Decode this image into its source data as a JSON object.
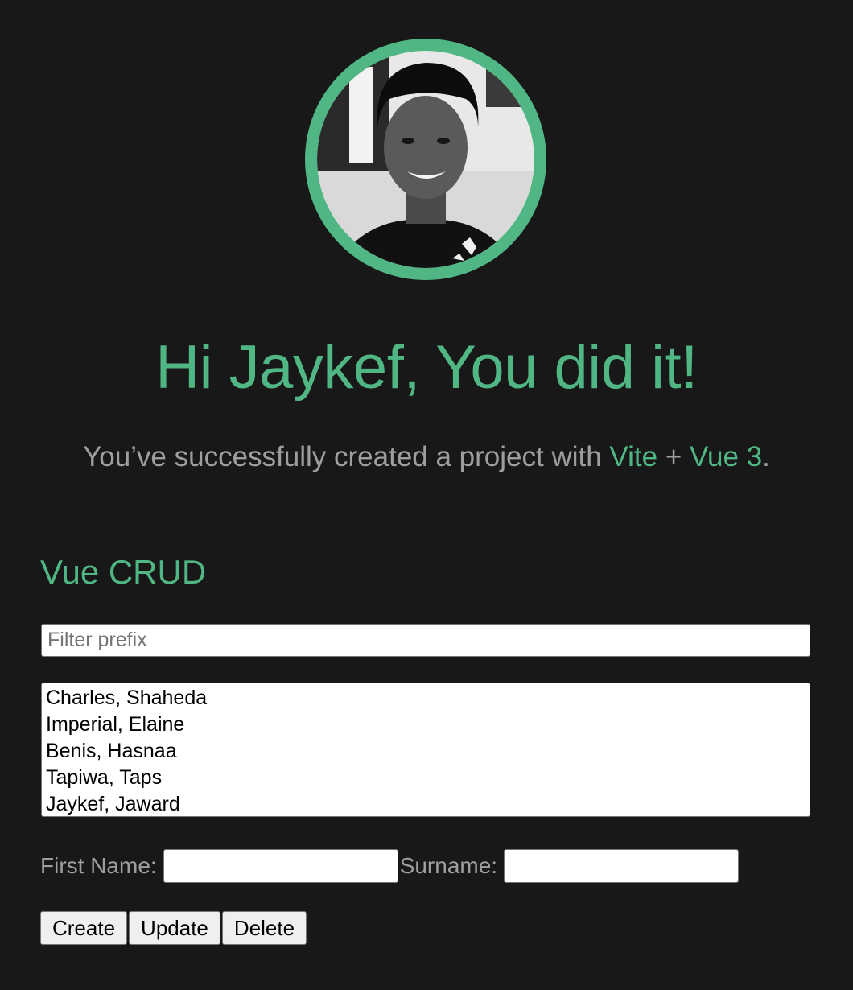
{
  "hero": {
    "greeting": "Hi Jaykef, You did it!",
    "subtitle_prefix": "You’ve successfully created a project with ",
    "link_vite": "Vite",
    "plus": " + ",
    "link_vue": "Vue 3",
    "period": "."
  },
  "crud": {
    "title": "Vue CRUD",
    "filter_placeholder": "Filter prefix",
    "filter_value": "",
    "people": [
      "Charles, Shaheda",
      "Imperial, Elaine",
      "Benis, Hasnaa",
      "Tapiwa, Taps",
      "Jaykef, Jaward"
    ],
    "first_name_label": "First Name:",
    "first_name_value": "",
    "surname_label": "Surname:",
    "surname_value": "",
    "buttons": {
      "create": "Create",
      "update": "Update",
      "delete": "Delete"
    }
  },
  "colors": {
    "accent": "#50b784",
    "background": "#181818",
    "muted_text": "#a3a3a3"
  }
}
